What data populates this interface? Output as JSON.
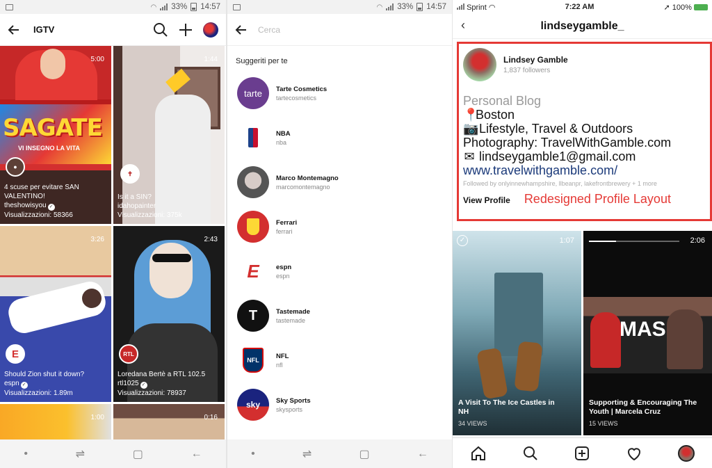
{
  "panel1": {
    "status": {
      "battery": "33%",
      "time": "14:57"
    },
    "title": "IGTV",
    "tiles": [
      {
        "duration": "5:00",
        "title": "4 scuse per evitare SAN VALENTINO!",
        "channel": "theshowisyou",
        "views": "Visualizzazioni: 58366"
      },
      {
        "duration": "1:44",
        "title": "Is it a SIN?",
        "channel": "idahopainter",
        "views": "Visualizzazioni: 375k"
      },
      {
        "duration": "3:26",
        "title": "Should Zion shut it down?",
        "channel": "espn",
        "views": "Visualizzazioni: 1.89m"
      },
      {
        "duration": "2:43",
        "title": "Loredana Bertè a RTL 102.5",
        "channel": "rtl1025",
        "views": "Visualizzazioni: 78937"
      },
      {
        "duration": "1:00"
      },
      {
        "duration": "0:16"
      }
    ],
    "banner_text": "SAGATE",
    "banner_sub": "VI INSEGNO LA VITA"
  },
  "panel2": {
    "status": {
      "battery": "33%",
      "time": "14:57"
    },
    "search_placeholder": "Cerca",
    "section_title": "Suggeriti per te",
    "suggestions": [
      {
        "name": "Tarte Cosmetics",
        "user": "tartecosmetics",
        "logo": "tarte"
      },
      {
        "name": "NBA",
        "user": "nba",
        "logo": "NBA"
      },
      {
        "name": "Marco Montemagno",
        "user": "marcomontemagno",
        "logo": ""
      },
      {
        "name": "Ferrari",
        "user": "ferrari",
        "logo": ""
      },
      {
        "name": "espn",
        "user": "espn",
        "logo": "E"
      },
      {
        "name": "Tastemade",
        "user": "tastemade",
        "logo": "T"
      },
      {
        "name": "NFL",
        "user": "nfl",
        "logo": "NFL"
      },
      {
        "name": "Sky Sports",
        "user": "skysports",
        "logo": "sky"
      }
    ]
  },
  "panel3": {
    "status": {
      "carrier": "Sprint",
      "time": "7:22 AM",
      "battery": "100%"
    },
    "username": "lindseygamble_",
    "profile": {
      "name": "Lindsey Gamble",
      "followers": "1,837 followers",
      "category": "Personal Blog",
      "location": "Boston",
      "interests": "Lifestyle, Travel & Outdoors",
      "photography": "Photography: TravelWithGamble.com",
      "email": "lindseygamble1@gmail.com",
      "website": "www.travelwithgamble.com/",
      "followed_by": "Followed by onlyinnewhampshire, llbeanpr, lakefrontbrewery + 1 more",
      "view_profile": "View Profile",
      "annotation": "Redesigned Profile Layout"
    },
    "videos": [
      {
        "duration": "1:07",
        "title": "A Visit To The Ice Castles in NH",
        "views": "34 VIEWS"
      },
      {
        "duration": "2:06",
        "title": "Supporting & Encouraging The Youth | Marcela Cruz",
        "views": "15 VIEWS"
      }
    ],
    "video2_sign": "MAS"
  }
}
